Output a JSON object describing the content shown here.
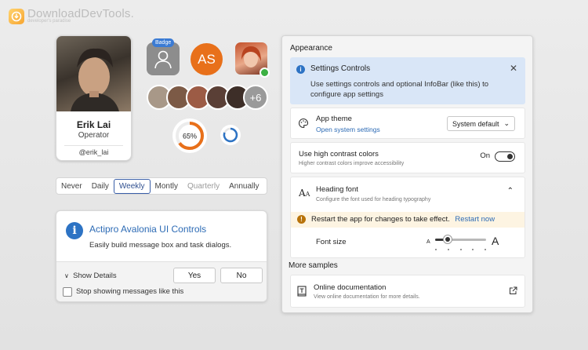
{
  "watermark": {
    "title": "DownloadDevTools.",
    "subtitle": "developer's paradise"
  },
  "profile": {
    "name": "Erik Lai",
    "role": "Operator",
    "handle": "@erik_lai"
  },
  "avatars": {
    "badge": "Badge",
    "initials": "AS",
    "group_more": "+6"
  },
  "progress": {
    "label": "65%",
    "value": 65
  },
  "schedule": {
    "options": [
      "Never",
      "Daily",
      "Weekly",
      "Montly",
      "Quarterly",
      "Annually"
    ],
    "selected": "Weekly",
    "disabled": [
      "Quarterly"
    ]
  },
  "message": {
    "title": "Actipro Avalonia UI Controls",
    "text": "Easily build message box and task dialogs.",
    "details": "Show Details",
    "yes": "Yes",
    "no": "No",
    "checkbox": "Stop showing messages like this"
  },
  "settings": {
    "section": "Appearance",
    "infobar": {
      "title": "Settings Controls",
      "message": "Use settings controls and optional InfoBar (like this) to configure app settings"
    },
    "theme": {
      "label": "App theme",
      "link": "Open system settings",
      "value": "System default"
    },
    "contrast": {
      "label": "Use high contrast colors",
      "desc": "Higher contrast colors improve accessibility",
      "state": "On"
    },
    "heading": {
      "label": "Heading font",
      "desc": "Configure the font used for heading typography"
    },
    "warning": {
      "text": "Restart the app for changes to take effect.",
      "link": "Restart now"
    },
    "font_size": {
      "label": "Font size",
      "small": "A",
      "large": "A",
      "value": 0.25
    },
    "more": "More samples",
    "docs": {
      "label": "Online documentation",
      "desc": "View online documentation for more details."
    }
  },
  "colors": {
    "accent": "#2d73c4",
    "orange": "#e8701a",
    "online": "#3cb043"
  }
}
